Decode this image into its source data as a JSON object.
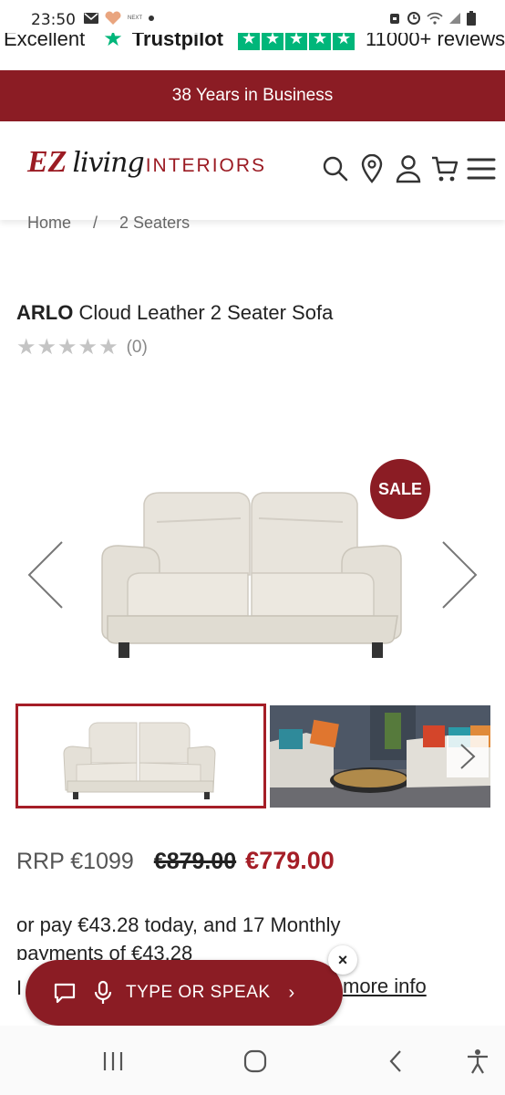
{
  "status_bar": {
    "time": "23:50",
    "left_icons": [
      "mail-icon",
      "heart-app-icon",
      "dot-icon"
    ],
    "right_icons": [
      "alarm-icon",
      "clock-icon",
      "wifi-icon",
      "signal-icon",
      "battery-icon"
    ]
  },
  "trustpilot": {
    "rating_word": "Excellent",
    "brand": "Trustpilot",
    "stars": 5,
    "review_count": "11000+ reviews"
  },
  "banner": {
    "text": "38 Years in Business"
  },
  "header": {
    "logo": {
      "ez": "EZ",
      "living": "living",
      "interiors": "INTERIORS"
    },
    "icons": [
      "search-icon",
      "location-icon",
      "account-icon",
      "cart-icon",
      "menu-icon"
    ]
  },
  "breadcrumb": {
    "items": [
      "Home",
      "/",
      "2 Seaters"
    ]
  },
  "product": {
    "brand": "ARLO",
    "name": "Cloud Leather 2 Seater Sofa",
    "rating_stars": 5,
    "rating_count": "(0)",
    "sale_badge": "SALE"
  },
  "price": {
    "rrp": "RRP €1099",
    "old": "€879.00",
    "new": "€779.00"
  },
  "finance": {
    "line1": "or pay €43.28 today, and 17 Monthly",
    "line2": "payments of €43.28",
    "line3": "I",
    "more_info": "more info"
  },
  "chat": {
    "label": "TYPE OR SPEAK",
    "arrow": "›",
    "close": "×"
  },
  "colors": {
    "brand_red": "#8b1c24",
    "price_red": "#a51e27",
    "trustpilot_green": "#00b67a"
  }
}
